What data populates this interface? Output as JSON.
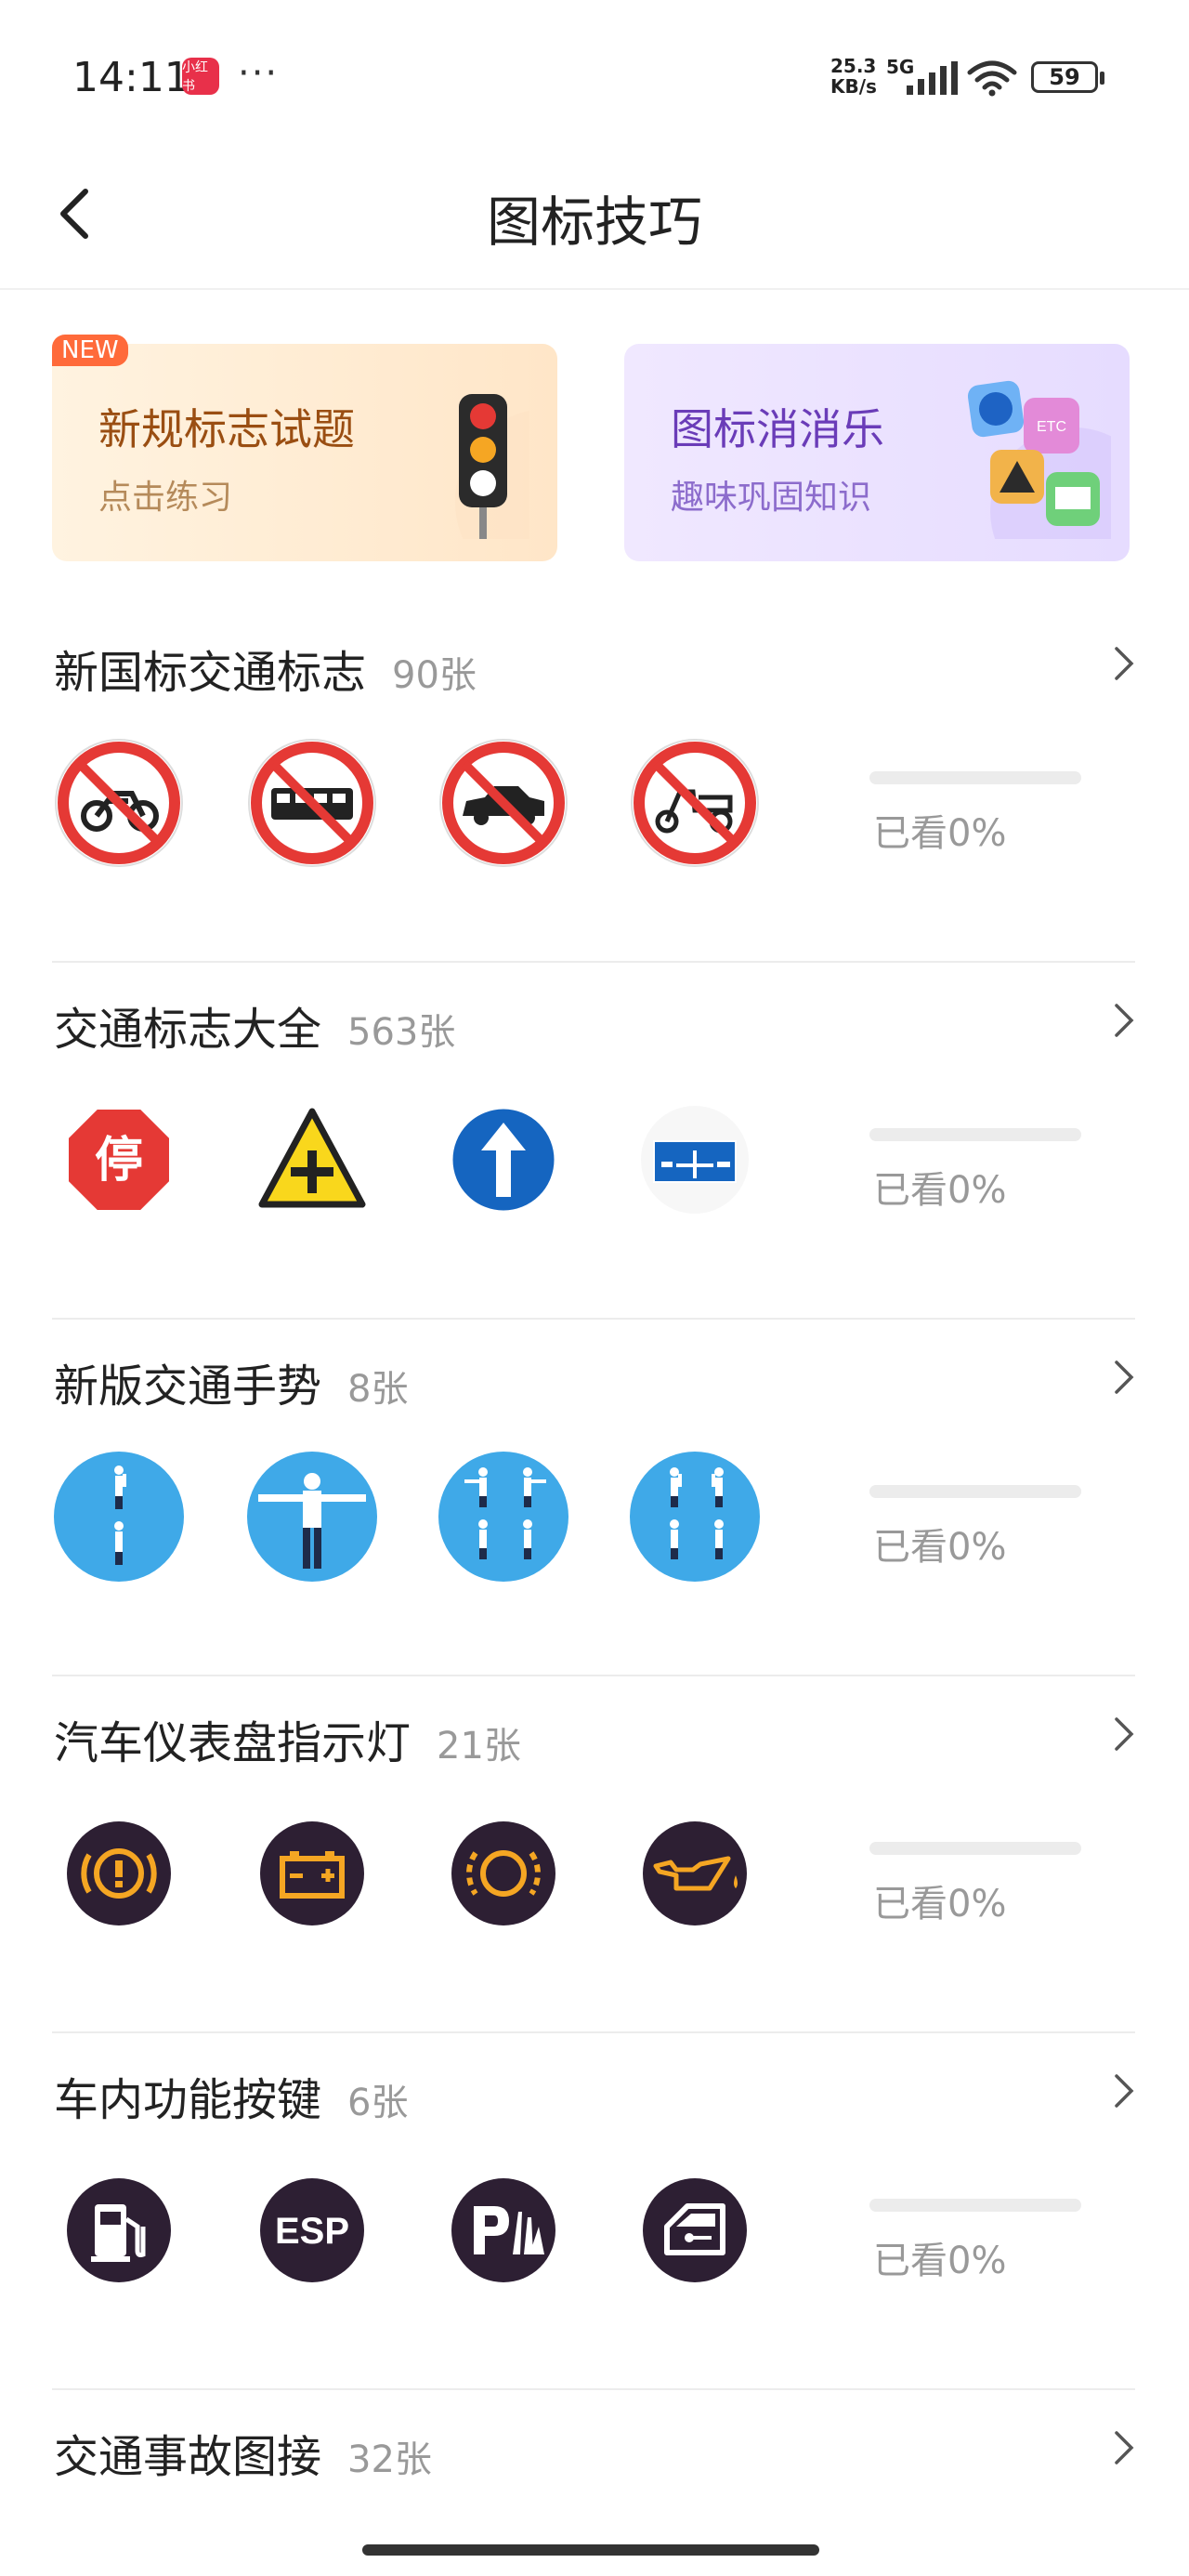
{
  "status_bar": {
    "time": "14:11",
    "app_badge": "小红书",
    "more": "···",
    "net_speed_value": "25.3",
    "net_speed_unit": "KB/s",
    "network": "5G",
    "battery": "59"
  },
  "header": {
    "title": "图标技巧",
    "back_icon": "chevron-left-icon"
  },
  "banners": [
    {
      "tag": "NEW",
      "title": "新规标志试题",
      "subtitle": "点击练习",
      "icon": "traffic-light-icon"
    },
    {
      "title": "图标消消乐",
      "subtitle": "趣味巩固知识",
      "icon": "sign-tiles-icon"
    }
  ],
  "sections": [
    {
      "title": "新国标交通标志",
      "count": "90张",
      "progress": 0,
      "viewed": "已看0%",
      "icons": [
        "no-motorcycle-icon",
        "no-bus-icon",
        "no-car-icon",
        "no-tricycle-icon"
      ]
    },
    {
      "title": "交通标志大全",
      "count": "563张",
      "progress": 0,
      "viewed": "已看0%",
      "icons": [
        "stop-sign-icon",
        "crossroad-warning-icon",
        "go-straight-icon",
        "direction-board-icon"
      ],
      "stop_sign_text": "停"
    },
    {
      "title": "新版交通手势",
      "count": "8张",
      "progress": 0,
      "viewed": "已看0%",
      "icons": [
        "police-gesture-stop-icon",
        "police-gesture-straight-icon",
        "police-gesture-left-turn-icon",
        "police-gesture-right-turn-icon"
      ]
    },
    {
      "title": "汽车仪表盘指示灯",
      "count": "21张",
      "progress": 0,
      "viewed": "已看0%",
      "icons": [
        "brake-warning-icon",
        "battery-warning-icon",
        "brake-pad-icon",
        "oil-pressure-icon"
      ]
    },
    {
      "title": "车内功能按键",
      "count": "6张",
      "progress": 0,
      "viewed": "已看0%",
      "icons": [
        "fuel-icon",
        "esp-icon",
        "parking-sensor-icon",
        "door-lock-icon"
      ],
      "esp_text": "ESP"
    },
    {
      "title": "交通事故图接",
      "count": "32张"
    }
  ],
  "colors": {
    "sign_red": "#e53935",
    "sign_blue": "#1565c0",
    "sign_yellow": "#f9d71c",
    "dash_icon_bg": "#2d1f33",
    "dash_icon_amber": "#f5a623",
    "gesture_sky": "#3fa9e8",
    "new_tag": "#ff6a3a"
  }
}
